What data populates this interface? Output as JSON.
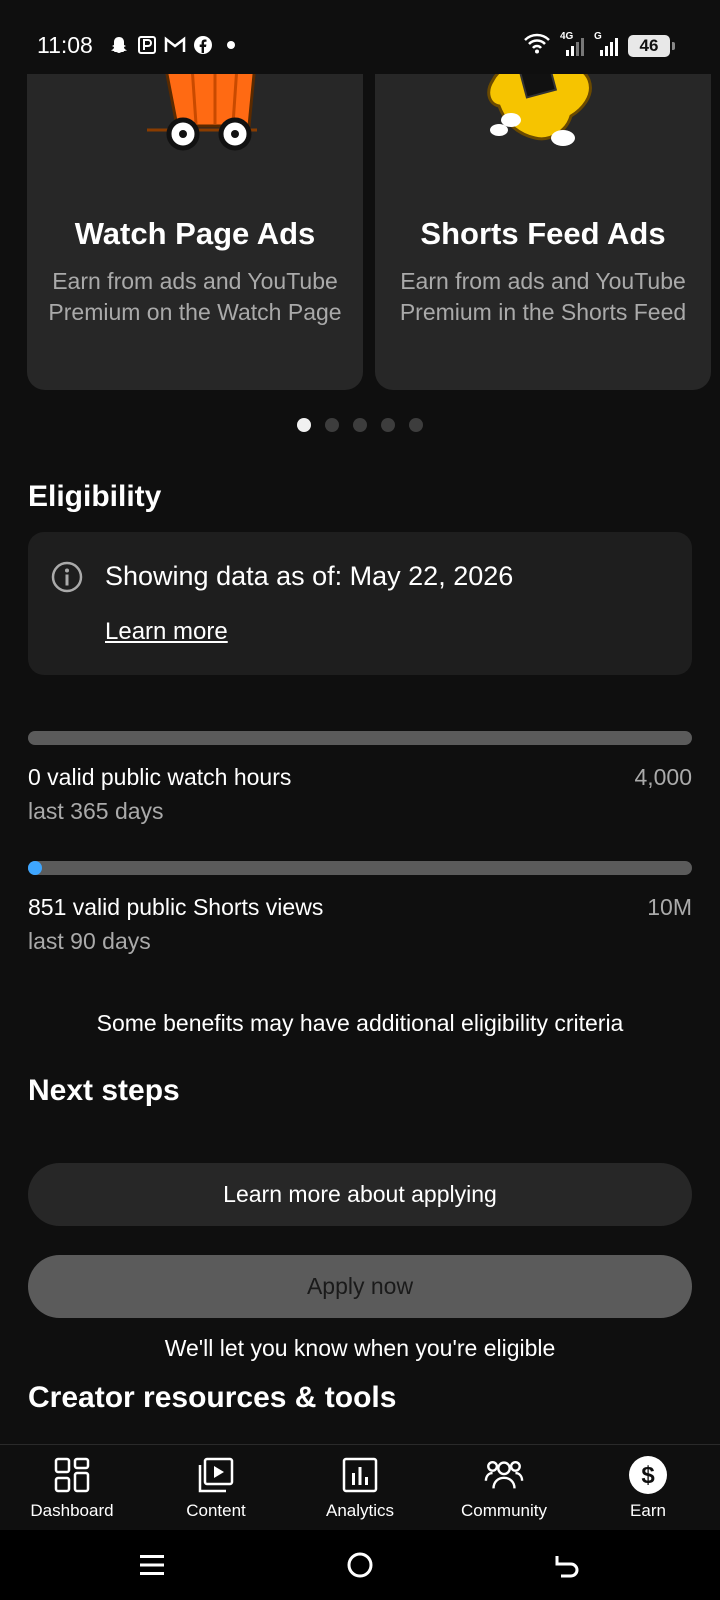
{
  "status_bar": {
    "time": "11:08",
    "battery": "46",
    "network_1": "4G",
    "network_2": "G"
  },
  "cards": [
    {
      "title": "Watch Page Ads",
      "description": "Earn from ads and YouTube Premium on the Watch Page"
    },
    {
      "title": "Shorts Feed Ads",
      "description": "Earn from ads and YouTube Premium in the Shorts Feed"
    }
  ],
  "carousel": {
    "pages": 5,
    "active_page": 1
  },
  "eligibility": {
    "title": "Eligibility",
    "data_as_of": "Showing data as of: May 22, 2026",
    "learn_more": "Learn more",
    "metrics": [
      {
        "label": "0 valid public watch hours",
        "sub": "last 365 days",
        "target": "4,000",
        "progress": 0.0
      },
      {
        "label": "851 valid public Shorts views",
        "sub": "last 90 days",
        "target": "10M",
        "progress": 0.0001
      }
    ],
    "note": "Some benefits may have additional eligibility criteria"
  },
  "next_steps": {
    "title": "Next steps",
    "learn_button": "Learn more about applying",
    "apply_button": "Apply now",
    "eligible_note": "We'll let you know when you're eligible"
  },
  "resources": {
    "title": "Creator resources & tools"
  },
  "bottom_nav": [
    {
      "label": "Dashboard",
      "icon": "dashboard-icon"
    },
    {
      "label": "Content",
      "icon": "content-icon"
    },
    {
      "label": "Analytics",
      "icon": "analytics-icon"
    },
    {
      "label": "Community",
      "icon": "community-icon"
    },
    {
      "label": "Earn",
      "icon": "earn-icon",
      "active": true
    }
  ],
  "colors": {
    "background": "#0f0f0f",
    "card": "#272727",
    "progress_track": "#5b5b5b",
    "progress_fill": "#3ea6ff"
  }
}
